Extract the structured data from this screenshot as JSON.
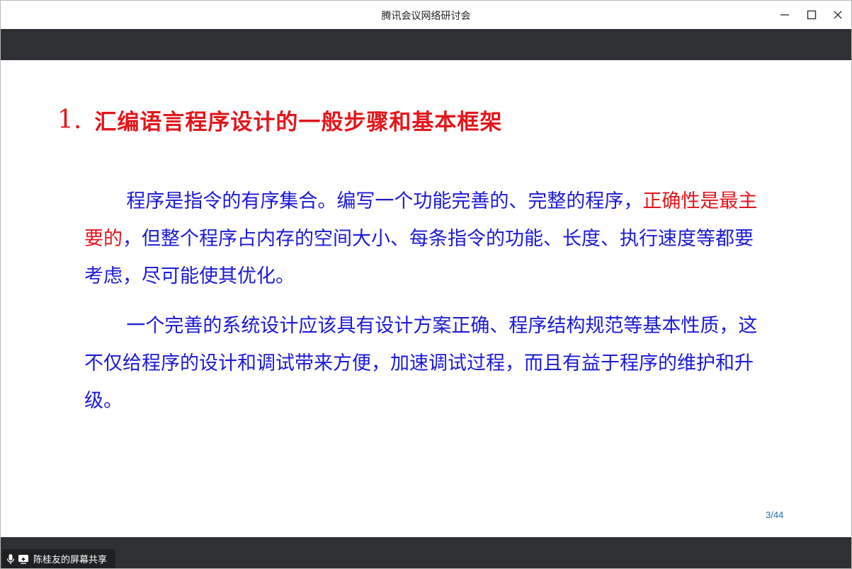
{
  "window": {
    "title": "腾讯会议网络研讨会"
  },
  "slide": {
    "title_number": "1.",
    "title_text": "汇编语言程序设计的一般步骤和基本框架",
    "paragraph1": {
      "part1": "程序是指令的有序集合。编写一个功能完善的、完整的程序，",
      "highlight": "正确性是最主要的",
      "part2": "，但整个程序占内存的空间大小、每条指令的功能、长度、执行速度等都要考虑，尽可能使其优化。"
    },
    "paragraph2": "一个完善的系统设计应该具有设计方案正确、程序结构规范等基本性质，这不仅给程序的设计和调试带来方便，加速调试过程，而且有益于程序的维护和升级。",
    "page_indicator": "3/44"
  },
  "share_bar": {
    "label": "陈桂友的屏幕共享"
  },
  "icons": {
    "minimize": "minimize-icon",
    "maximize": "maximize-icon",
    "close": "close-icon",
    "microphone": "microphone-icon",
    "screen_share": "screen-share-icon"
  },
  "colors": {
    "title_red": "#e3161b",
    "body_blue": "#1a1ad6",
    "bar_dark": "#2e3033"
  }
}
